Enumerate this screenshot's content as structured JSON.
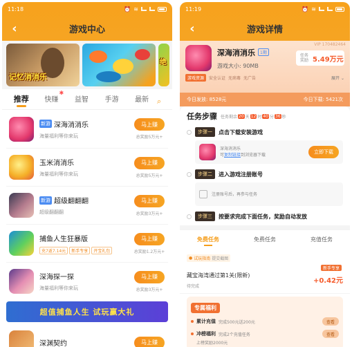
{
  "left": {
    "status_time": "11:18",
    "title": "游戏中心",
    "banners": [
      {
        "caption": "记忆消消乐"
      },
      {
        "caption": ""
      },
      {
        "caption": "绝"
      }
    ],
    "tabs": [
      "推荐",
      "快赚",
      "益智",
      "手游",
      "最新"
    ],
    "hot_mark": "HOT",
    "games": [
      {
        "name": "深海消消乐",
        "new": "新游",
        "desc": "海量福利等你来玩",
        "button": "马上赚",
        "reward": "总奖励5万元+"
      },
      {
        "name": "玉米消消乐",
        "new": "",
        "desc": "海量福利等你来玩",
        "button": "马上赚",
        "reward": "总奖励5万元+"
      },
      {
        "name": "超级翻翻翻",
        "new": "新游",
        "desc": "超级翻翻翻",
        "button": "马上赚",
        "reward": "总奖励3万元+"
      },
      {
        "name": "捕鱼人生狂暴版",
        "new": "",
        "tags": [
          "充7返7.14元",
          "新手专享",
          "开宝礼包"
        ],
        "button": "马上赚",
        "reward": "总奖励1.2万元+"
      },
      {
        "name": "深海探一探",
        "new": "",
        "desc": "海量福利等你来玩",
        "button": "马上赚",
        "reward": "总奖励3万元+"
      }
    ],
    "promo": "超值捕鱼人生 试玩赢大礼",
    "last_game": {
      "name": "深渊契约",
      "button": "马上赚"
    }
  },
  "right": {
    "status_time": "11:19",
    "title": "游戏详情",
    "vip_code": "VIP 170482464",
    "game_name": "深海消消乐",
    "period": "1期",
    "size_label": "游戏大小: 90MB",
    "reward_label": "任务奖励",
    "reward_value": "5.49万元",
    "tags": {
      "hot": "游戏资源",
      "t1": "安全认证",
      "t2": "无病毒",
      "t3": "无广告",
      "expand": "展开"
    },
    "today_downloads": "今日发放: 8528元",
    "today_installs": "今日下载: 5421次",
    "steps_title": "任务步骤",
    "remaining_label": "任务剩余",
    "time_boxes": [
      "20",
      "12",
      "40",
      "36"
    ],
    "time_units": [
      "天",
      "时",
      "分",
      "秒"
    ],
    "steps": [
      {
        "label": "步骤一",
        "text": "点击下载安装游戏"
      },
      {
        "label": "步骤二",
        "text": "进入游戏注册账号"
      },
      {
        "label": "步骤三",
        "text": "按要求完成下面任务，奖励自动发放"
      }
    ],
    "step1_detail": {
      "name": "深海消消乐",
      "hint_prefix": "可",
      "hint_link": "复制链接",
      "hint_suffix": "到浏览器下载",
      "button": "立即下载"
    },
    "step2_detail": "注册账号后，再参与任务",
    "task_tabs": [
      "免费任务",
      "免费任务",
      "充值任务"
    ],
    "trial_chip": {
      "label": "试玩指南",
      "muted": "提交截图"
    },
    "task": {
      "badge": "新手专享",
      "name": "藏宝海湾通过第1关(限新)",
      "status": "待完成",
      "reward": "+0.42元"
    },
    "welfare_title": "专属福利",
    "welfare": [
      {
        "name": "累计充值",
        "desc": "完成500元送200元",
        "button": "查看"
      },
      {
        "name": "冲榜福利",
        "desc": "完成2个充值任务",
        "desc2": "上榜奖励2000元",
        "button": "查看"
      }
    ]
  }
}
